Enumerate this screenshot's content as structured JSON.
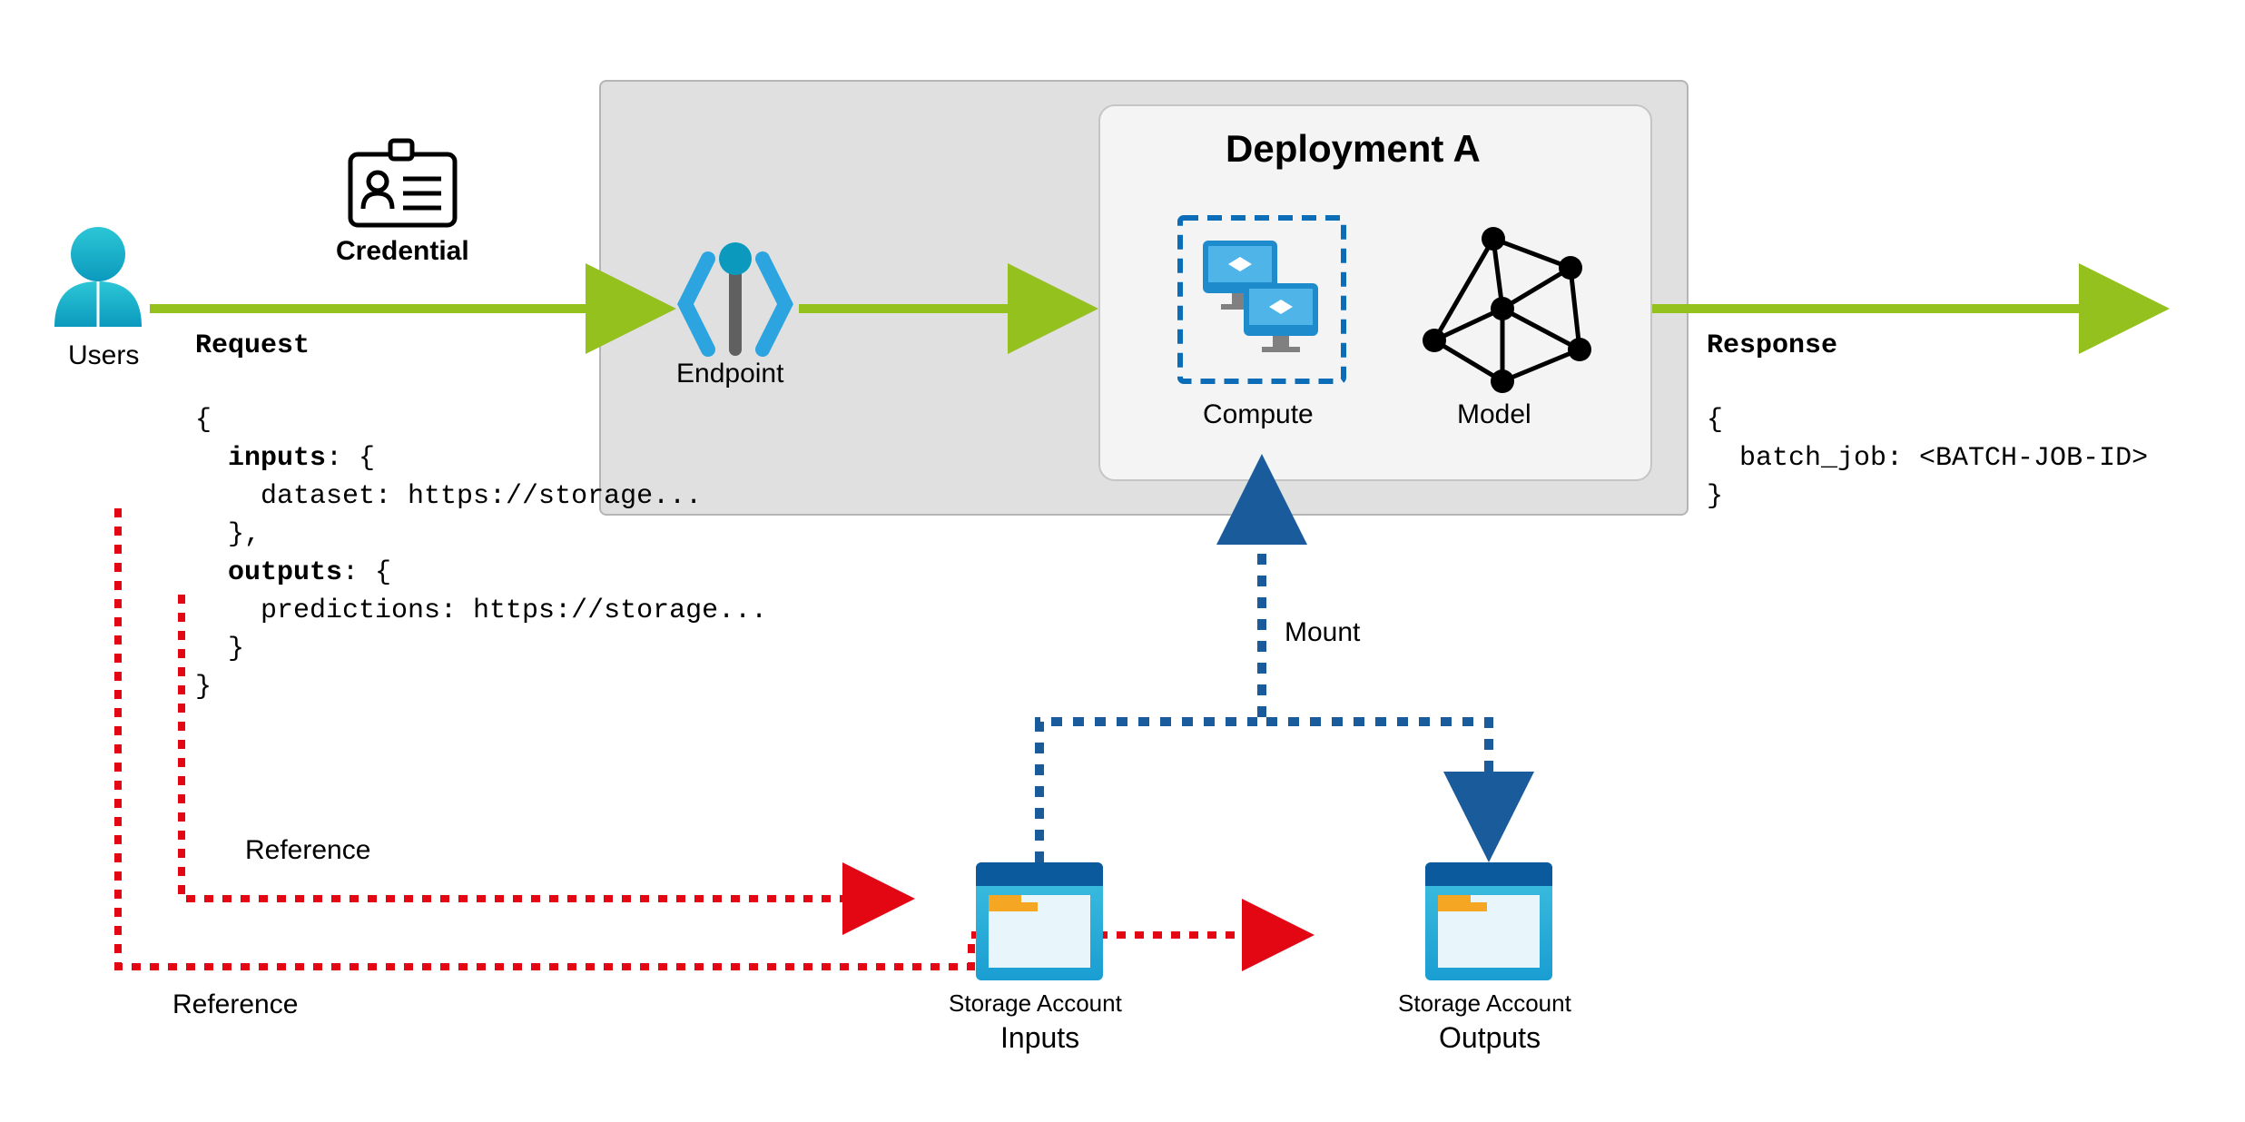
{
  "nodes": {
    "users": "Users",
    "credential": "Credential",
    "endpoint": "Endpoint",
    "deployment_title": "Deployment A",
    "compute": "Compute",
    "model": "Model",
    "storage_inputs_title": "Storage Account",
    "storage_inputs_sub": "Inputs",
    "storage_outputs_title": "Storage Account",
    "storage_outputs_sub": "Outputs"
  },
  "edges": {
    "reference1": "Reference",
    "reference2": "Reference",
    "mount": "Mount"
  },
  "request": {
    "title": "Request",
    "line1": "{",
    "line2_key": "inputs",
    "line2_rest": ": {",
    "line3": "    dataset: https://storage...",
    "line4": "  },",
    "line5_key": "outputs",
    "line5_rest": ": {",
    "line6": "    predictions: https://storage...",
    "line7": "  }",
    "line8": "}"
  },
  "response": {
    "title": "Response",
    "line1": "{",
    "line2": "  batch_job: <BATCH-JOB-ID>",
    "line3": "}"
  },
  "colors": {
    "flow_green": "#95C11F",
    "ref_red": "#E30613",
    "mount_blue": "#1A5C9B",
    "azure_blue": "#1E8BCD",
    "azure_dark": "#0B5A9D"
  }
}
